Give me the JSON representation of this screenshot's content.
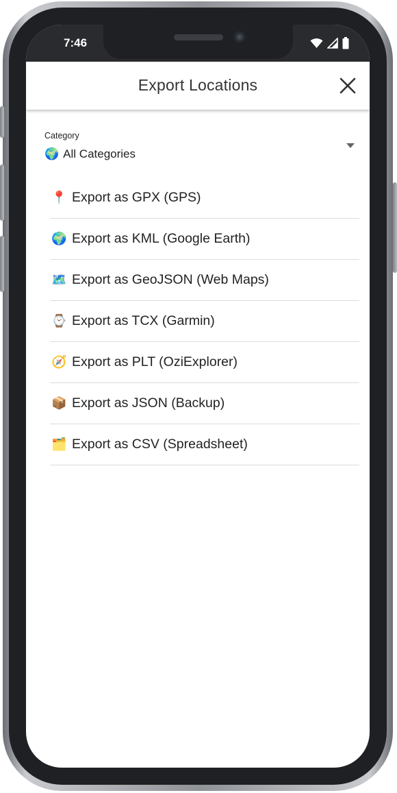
{
  "status_bar": {
    "time": "7:46"
  },
  "header": {
    "title": "Export Locations",
    "close_label": "✕"
  },
  "category": {
    "label": "Category",
    "value": "All Categories",
    "value_emoji": "🌍"
  },
  "export_options": [
    {
      "emoji": "📍",
      "label": "Export as GPX (GPS)"
    },
    {
      "emoji": "🌍",
      "label": "Export as KML (Google Earth)"
    },
    {
      "emoji": "🗺️",
      "label": "Export as GeoJSON (Web Maps)"
    },
    {
      "emoji": "⌚",
      "label": "Export as TCX (Garmin)"
    },
    {
      "emoji": "🧭",
      "label": "Export as PLT (OziExplorer)"
    },
    {
      "emoji": "📦",
      "label": "Export as JSON (Backup)"
    },
    {
      "emoji": "🗂️",
      "label": "Export as CSV (Spreadsheet)"
    }
  ]
}
